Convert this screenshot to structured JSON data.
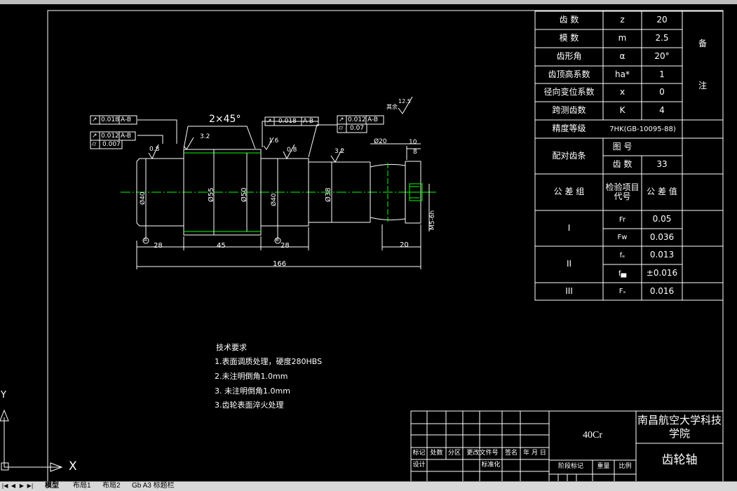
{
  "colors": {
    "background": "#000000",
    "lines": "#ffffff",
    "centerline": "#00ff00",
    "tabbar": "#d8d8d8"
  },
  "param_table": {
    "rows": [
      {
        "label": "齿 数",
        "symbol": "z",
        "value": "20"
      },
      {
        "label": "模 数",
        "symbol": "m",
        "value": "2.5"
      },
      {
        "label": "齿形角",
        "symbol": "α",
        "value": "20°"
      },
      {
        "label": "齿顶高系数",
        "symbol": "ha*",
        "value": "1"
      },
      {
        "label": "径向变位系数",
        "symbol": "x",
        "value": "0"
      },
      {
        "label": "跨测齿数",
        "symbol": "K",
        "value": "4"
      }
    ],
    "accuracy_label": "精度等级",
    "accuracy_value": "7HK(GB-10095-88)",
    "remark_1": "备",
    "remark_2": "注",
    "mating_label": "配对齿条",
    "drawing_no_label": "图 号",
    "teeth_label": "齿 数",
    "teeth_value": "33",
    "tolerance_group_label": "公 差 组",
    "check_item_label": "检验项目代号",
    "tolerance_value_label": "公 差 值",
    "groups": [
      {
        "name": "I",
        "items": [
          {
            "code": "Fr",
            "value": "0.05"
          },
          {
            "code": "Fw",
            "value": "0.036"
          }
        ]
      },
      {
        "name": "II",
        "items": [
          {
            "code": "fₑ",
            "value": "0.013"
          },
          {
            "code": "f▄",
            "value": "±0.016"
          }
        ]
      },
      {
        "name": "III",
        "items": [
          {
            "code": "Fₛ",
            "value": "0.016"
          }
        ]
      }
    ]
  },
  "drawing": {
    "chamfer": "2×45°",
    "dims": {
      "d1": "Ø40",
      "d2": "Ø55",
      "d3": "Ø50",
      "d4": "Ø40",
      "d5": "Ø38",
      "d6": "Ø20",
      "m5": "M5-6h",
      "l1": "28",
      "l2": "45",
      "l3": "28",
      "l4": "20",
      "total": "166",
      "l5": "10",
      "l6": "8"
    },
    "roughness": {
      "r1": "0.8",
      "r2": "3.2",
      "r3": "1.6",
      "r4": "0.8",
      "r5": "3.2",
      "rest": "其余",
      "rest_value": "12.5"
    },
    "tolerance_frames": [
      {
        "tol": "0.018",
        "ref": "A-B"
      },
      {
        "tol": "0.012",
        "ref": "A-B"
      },
      {
        "tol": "0.007",
        "ref": ""
      },
      {
        "tol": "0.018",
        "ref": "A-B"
      },
      {
        "tol": "0.012",
        "ref": "A-B"
      },
      {
        "tol": "0.07",
        "ref": ""
      }
    ],
    "datum_a": "A",
    "datum_b": "B"
  },
  "notes": {
    "title": "技术要求",
    "items": [
      "1.表面调质处理，硬度280HBS",
      "2.未注明倒角1.0mm",
      "3. 未注明倒角1.0mm",
      "3.齿轮表面淬火处理"
    ]
  },
  "title_block": {
    "headers": [
      "标记",
      "处数",
      "分区",
      "更改文件号",
      "签名",
      "年 月 日"
    ],
    "design": "设计",
    "standard": "标准化",
    "stage": "阶段标记",
    "weight": "重量",
    "scale": "比例",
    "material": "40Cr",
    "org": "南昌航空大学科技学院",
    "part": "齿轮轴"
  },
  "ucs": {
    "x": "X",
    "y": "Y"
  },
  "tabs": [
    "模型",
    "布局1",
    "布局2",
    "Gb A3 标题栏"
  ]
}
